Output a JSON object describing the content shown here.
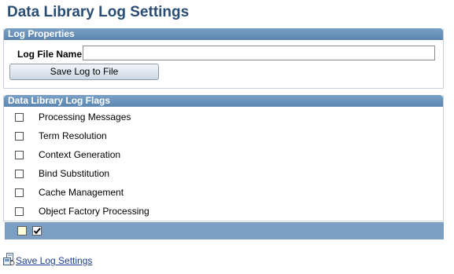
{
  "page": {
    "title": "Data Library Log Settings"
  },
  "log_properties": {
    "header": "Log Properties",
    "log_file_name_label": "Log File Name",
    "log_file_name_value": "",
    "save_button_label": "Save Log to File"
  },
  "log_flags": {
    "header": "Data Library Log Flags",
    "items": [
      {
        "label": "Processing Messages",
        "checked": false
      },
      {
        "label": "Term Resolution",
        "checked": false
      },
      {
        "label": "Context Generation",
        "checked": false
      },
      {
        "label": "Bind Substitution",
        "checked": false
      },
      {
        "label": "Cache Management",
        "checked": false
      },
      {
        "label": "Object Factory Processing",
        "checked": false
      }
    ]
  },
  "toolbar": {
    "check_all_icon": "check-all-icon",
    "uncheck_all_icon": "checkmark-icon"
  },
  "footer": {
    "save_settings_icon": "save-settings-icon",
    "save_settings_label": "Save Log Settings"
  },
  "colors": {
    "title": "#2a4d74",
    "header_bar": "#5b86b0",
    "toolbar_bar": "#7b9ec2",
    "link": "#1b3f8c"
  }
}
